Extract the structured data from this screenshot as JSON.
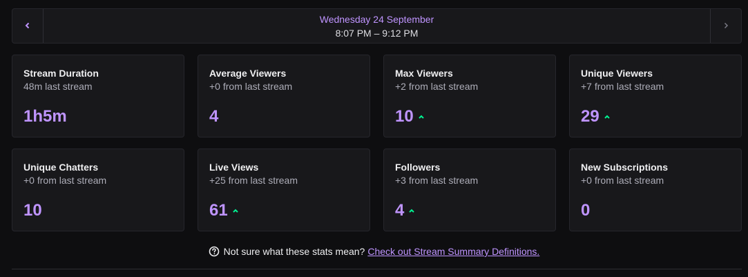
{
  "stream_nav": {
    "date": "Wednesday 24 September",
    "time_range": "8:07 PM – 9:12 PM",
    "prev_icon": "chevron-left-icon",
    "next_icon": "chevron-right-icon"
  },
  "stats": [
    {
      "title": "Stream Duration",
      "comparison": "48m last stream",
      "value": "1h5m",
      "trend": "none"
    },
    {
      "title": "Average Viewers",
      "comparison": "+0 from last stream",
      "value": "4",
      "trend": "none"
    },
    {
      "title": "Max Viewers",
      "comparison": "+2 from last stream",
      "value": "10",
      "trend": "up"
    },
    {
      "title": "Unique Viewers",
      "comparison": "+7 from last stream",
      "value": "29",
      "trend": "up"
    },
    {
      "title": "Unique Chatters",
      "comparison": "+0 from last stream",
      "value": "10",
      "trend": "none"
    },
    {
      "title": "Live Views",
      "comparison": "+25 from last stream",
      "value": "61",
      "trend": "up"
    },
    {
      "title": "Followers",
      "comparison": "+3 from last stream",
      "value": "4",
      "trend": "up"
    },
    {
      "title": "New Subscriptions",
      "comparison": "+0 from last stream",
      "value": "0",
      "trend": "none"
    }
  ],
  "footer": {
    "question": "Not sure what these stats mean?",
    "link_text": "Check out Stream Summary Definitions.",
    "icon": "help-circle-icon"
  },
  "colors": {
    "accent": "#bf94ff",
    "trend_up": "#00f593",
    "background": "#0e0e10",
    "card": "#18181b"
  }
}
